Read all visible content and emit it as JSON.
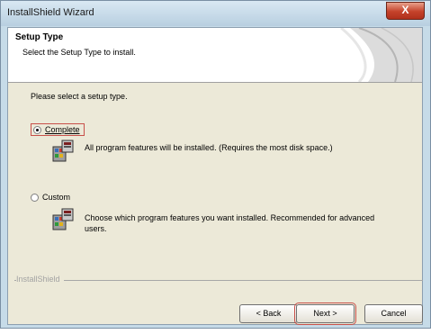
{
  "window": {
    "title": "InstallShield Wizard",
    "close_glyph": "X"
  },
  "header": {
    "title": "Setup Type",
    "subtitle": "Select the Setup Type to install."
  },
  "body": {
    "prompt": "Please select a setup type."
  },
  "options": [
    {
      "label": "Complete",
      "selected": true,
      "description": "All program features will be installed. (Requires the most disk space.)"
    },
    {
      "label": "Custom",
      "selected": false,
      "description": "Choose which program features you want installed. Recommended for advanced users."
    }
  ],
  "footer": {
    "brand": "InstallShield"
  },
  "buttons": {
    "back": "< Back",
    "next": "Next >",
    "cancel": "Cancel"
  },
  "colors": {
    "focus_border": "#c8504a",
    "close_button": "#c4422a",
    "dialog_face": "#ece9d8"
  },
  "icons": [
    "close-icon",
    "feature-install-icon",
    "feature-custom-icon"
  ]
}
